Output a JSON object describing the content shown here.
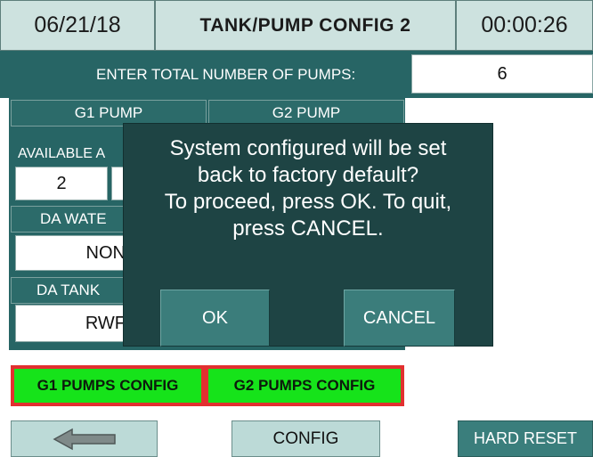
{
  "header": {
    "date": "06/21/18",
    "title": "TANK/PUMP CONFIG 2",
    "time": "00:00:26"
  },
  "pumps": {
    "total_label": "ENTER TOTAL NUMBER OF PUMPS:",
    "total_value": "6"
  },
  "groups": {
    "g1_label": "G1 PUMP",
    "g2_label": "G2 PUMP",
    "available_label": "AVAILABLE A",
    "available_value": "2",
    "da_water_label": "DA WATE",
    "da_water_value": "NON",
    "da_tank_label": "DA TANK",
    "da_tank_value": "RWF"
  },
  "dialog": {
    "message_lines": [
      "System configured will be set",
      "back to factory default?",
      "To proceed, press OK. To quit,",
      "press CANCEL."
    ],
    "ok_label": "OK",
    "cancel_label": "CANCEL"
  },
  "config_buttons": {
    "g1": "G1 PUMPS CONFIG",
    "g2": "G2 PUMPS CONFIG"
  },
  "footer": {
    "back_icon": "left-arrow-icon",
    "config_label": "CONFIG",
    "hard_reset_label": "HARD RESET"
  },
  "colors": {
    "panel": "#276565",
    "dialog": "#1e4444",
    "header": "#cde2df",
    "config_green": "#16e31a",
    "config_border": "#e23030"
  }
}
